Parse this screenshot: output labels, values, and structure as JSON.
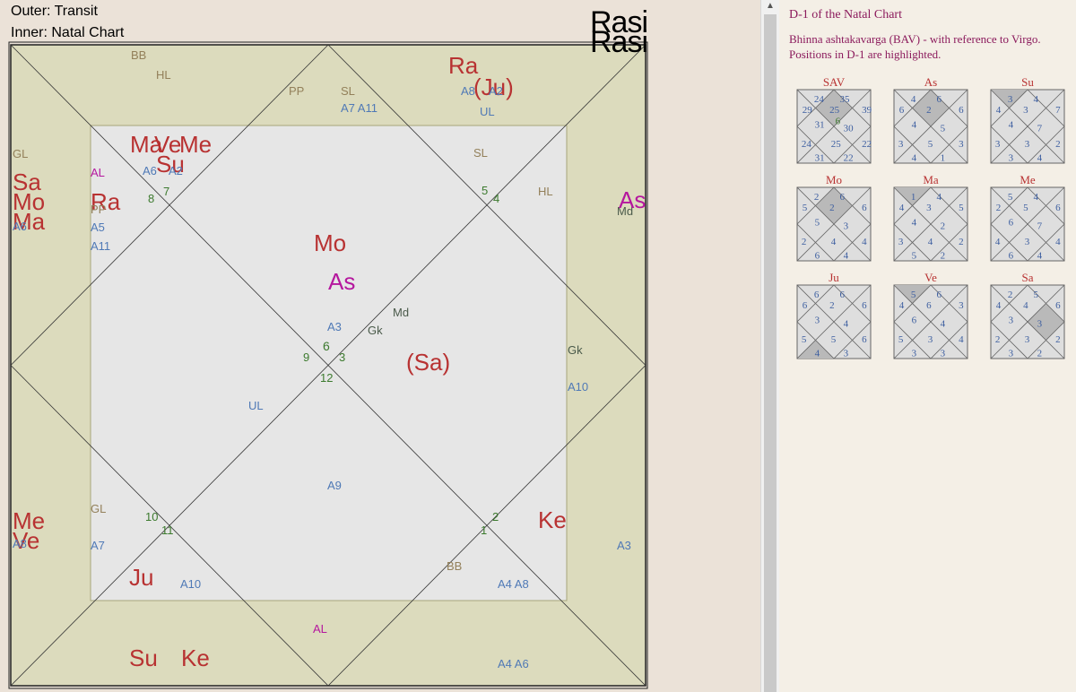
{
  "header": {
    "outer": "Outer: Transit",
    "inner": "Natal Chart",
    "inner_prefix": "Inner: ",
    "rasi": "Rasi"
  },
  "colors": {
    "planet_red": "#b83232",
    "ascendant_magenta": "#b5179e",
    "arudha_blue": "#4f79b6",
    "special_brown": "#93805a",
    "house_green": "#3c7a2e",
    "upagraha_dark": "#4a5a4a",
    "outer_fill": "#dcdbbd",
    "inner_fill": "#e6e6e6"
  },
  "chart_labels": [
    {
      "t": "BB",
      "c": "special_brown",
      "s": 13
    },
    {
      "t": "HL",
      "c": "special_brown",
      "s": 13
    },
    {
      "t": "PP",
      "c": "special_brown",
      "s": 13
    },
    {
      "t": "SL",
      "c": "special_brown",
      "s": 13
    },
    {
      "t": "A7 A11",
      "c": "arudha_blue",
      "s": 13
    },
    {
      "t": "Ra",
      "c": "planet_red",
      "s": 26
    },
    {
      "t": "(Ju)",
      "c": "planet_red",
      "s": 26
    },
    {
      "t": "A8",
      "c": "arudha_blue",
      "s": 13
    },
    {
      "t": "A2",
      "c": "arudha_blue",
      "s": 13
    },
    {
      "t": "UL",
      "c": "arudha_blue",
      "s": 13
    },
    {
      "t": "GL",
      "c": "special_brown",
      "s": 13
    },
    {
      "t": "Sa",
      "c": "planet_red",
      "s": 26
    },
    {
      "t": "Mo",
      "c": "planet_red",
      "s": 26
    },
    {
      "t": "Ma",
      "c": "planet_red",
      "s": 26
    },
    {
      "t": "A6",
      "c": "arudha_blue",
      "s": 13
    },
    {
      "t": "Ma",
      "c": "planet_red",
      "s": 26
    },
    {
      "t": "Ve",
      "c": "planet_red",
      "s": 26
    },
    {
      "t": "Me",
      "c": "planet_red",
      "s": 26
    },
    {
      "t": "Su",
      "c": "planet_red",
      "s": 26
    },
    {
      "t": "AL",
      "c": "ascendant_magenta",
      "s": 13
    },
    {
      "t": "A6",
      "c": "arudha_blue",
      "s": 13
    },
    {
      "t": "A2",
      "c": "arudha_blue",
      "s": 13
    },
    {
      "t": "8",
      "c": "house_green",
      "s": 13
    },
    {
      "t": "7",
      "c": "house_green",
      "s": 13
    },
    {
      "t": "Ra",
      "c": "planet_red",
      "s": 26
    },
    {
      "t": "PP",
      "c": "special_brown",
      "s": 13
    },
    {
      "t": "A5",
      "c": "arudha_blue",
      "s": 13
    },
    {
      "t": "A11",
      "c": "arudha_blue",
      "s": 13
    },
    {
      "t": "SL",
      "c": "special_brown",
      "s": 13
    },
    {
      "t": "5",
      "c": "house_green",
      "s": 13
    },
    {
      "t": "4",
      "c": "house_green",
      "s": 13
    },
    {
      "t": "HL",
      "c": "special_brown",
      "s": 13
    },
    {
      "t": "Md",
      "c": "upagraha_dark",
      "s": 13
    },
    {
      "t": "As",
      "c": "ascendant_magenta",
      "s": 26
    },
    {
      "t": "Mo",
      "c": "planet_red",
      "s": 26
    },
    {
      "t": "As",
      "c": "ascendant_magenta",
      "s": 26
    },
    {
      "t": "A3",
      "c": "arudha_blue",
      "s": 13
    },
    {
      "t": "6",
      "c": "house_green",
      "s": 14
    },
    {
      "t": "9",
      "c": "house_green",
      "s": 13
    },
    {
      "t": "3",
      "c": "house_green",
      "s": 13
    },
    {
      "t": "12",
      "c": "house_green",
      "s": 13
    },
    {
      "t": "Md",
      "c": "upagraha_dark",
      "s": 13
    },
    {
      "t": "Gk",
      "c": "upagraha_dark",
      "s": 13
    },
    {
      "t": "(Sa)",
      "c": "planet_red",
      "s": 26
    },
    {
      "t": "Gk",
      "c": "upagraha_dark",
      "s": 13
    },
    {
      "t": "A10",
      "c": "arudha_blue",
      "s": 13
    },
    {
      "t": "UL",
      "c": "arudha_blue",
      "s": 13
    },
    {
      "t": "A9",
      "c": "arudha_blue",
      "s": 13
    },
    {
      "t": "GL",
      "c": "special_brown",
      "s": 13
    },
    {
      "t": "10",
      "c": "house_green",
      "s": 13
    },
    {
      "t": "11",
      "c": "house_green",
      "s": 13
    },
    {
      "t": "A7",
      "c": "arudha_blue",
      "s": 13
    },
    {
      "t": "Me",
      "c": "planet_red",
      "s": 26
    },
    {
      "t": "Ve",
      "c": "planet_red",
      "s": 26
    },
    {
      "t": "A8",
      "c": "arudha_blue",
      "s": 13
    },
    {
      "t": "Ju",
      "c": "planet_red",
      "s": 26
    },
    {
      "t": "A10",
      "c": "arudha_blue",
      "s": 13
    },
    {
      "t": "2",
      "c": "house_green",
      "s": 13
    },
    {
      "t": "1",
      "c": "house_green",
      "s": 13
    },
    {
      "t": "Ke",
      "c": "planet_red",
      "s": 26
    },
    {
      "t": "BB",
      "c": "special_brown",
      "s": 13
    },
    {
      "t": "A4 A8",
      "c": "arudha_blue",
      "s": 13
    },
    {
      "t": "A3",
      "c": "arudha_blue",
      "s": 13
    },
    {
      "t": "AL",
      "c": "ascendant_magenta",
      "s": 13
    },
    {
      "t": "Su",
      "c": "planet_red",
      "s": 26
    },
    {
      "t": "Ke",
      "c": "planet_red",
      "s": 26
    },
    {
      "t": "A4 A6",
      "c": "arudha_blue",
      "s": 13
    }
  ],
  "right_panel": {
    "title": "D-1 of the Natal Chart",
    "description": "Bhinna ashtakavarga (BAV) - with reference to Virgo. Positions in D-1 are highlighted.",
    "bav_charts": [
      {
        "name": "SAV",
        "highlight": 2,
        "values": [
          "24",
          "35",
          "29",
          "25",
          "39",
          "31",
          "6",
          "30",
          "24",
          "25",
          "22",
          "31",
          "22"
        ]
      },
      {
        "name": "As",
        "highlight": 2,
        "values": [
          "4",
          "6",
          "6",
          "2",
          "6",
          "4",
          "",
          "5",
          "3",
          "5",
          "3",
          "4",
          "1"
        ]
      },
      {
        "name": "Su",
        "highlight": 0,
        "values": [
          "3",
          "4",
          "4",
          "3",
          "7",
          "4",
          "",
          "7",
          "3",
          "3",
          "2",
          "3",
          "4"
        ]
      },
      {
        "name": "Mo",
        "highlight": 2,
        "values": [
          "2",
          "6",
          "5",
          "2",
          "6",
          "5",
          "",
          "3",
          "2",
          "4",
          "4",
          "6",
          "4"
        ]
      },
      {
        "name": "Ma",
        "highlight": 0,
        "values": [
          "1",
          "4",
          "4",
          "3",
          "5",
          "4",
          "",
          "2",
          "3",
          "4",
          "2",
          "5",
          "2"
        ]
      },
      {
        "name": "Me",
        "highlight": -1,
        "values": [
          "5",
          "4",
          "2",
          "5",
          "6",
          "6",
          "",
          "7",
          "4",
          "3",
          "4",
          "6",
          "4"
        ]
      },
      {
        "name": "Ju",
        "highlight": 12,
        "values": [
          "6",
          "6",
          "6",
          "2",
          "6",
          "3",
          "",
          "4",
          "5",
          "5",
          "6",
          "4",
          "3"
        ]
      },
      {
        "name": "Ve",
        "highlight": 0,
        "values": [
          "5",
          "6",
          "4",
          "6",
          "3",
          "6",
          "",
          "4",
          "5",
          "3",
          "4",
          "3",
          "3"
        ]
      },
      {
        "name": "Sa",
        "highlight": 8,
        "values": [
          "2",
          "5",
          "4",
          "4",
          "6",
          "3",
          "",
          "3",
          "2",
          "3",
          "2",
          "3",
          "2"
        ]
      }
    ]
  }
}
